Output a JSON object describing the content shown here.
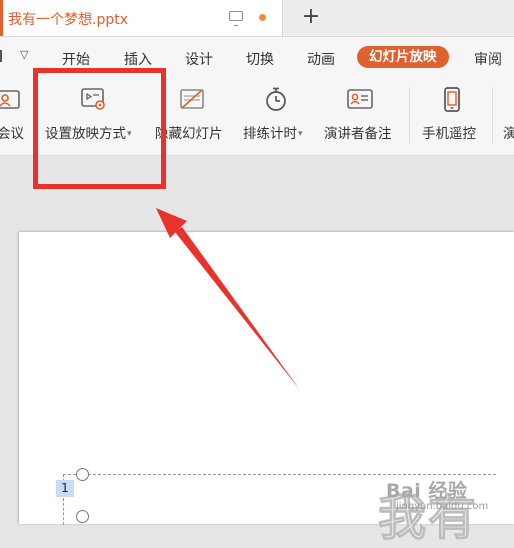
{
  "document": {
    "title": "我有一个梦想.pptx",
    "new_tab_symbol": "+",
    "accent_color": "#e0602e",
    "unsaved_dot_color": "#e8903b"
  },
  "menu": {
    "quick_access_dropdown": "▽",
    "items": [
      {
        "label": "开始"
      },
      {
        "label": "插入"
      },
      {
        "label": "设计"
      },
      {
        "label": "切换"
      },
      {
        "label": "动画"
      },
      {
        "label": "幻灯片放映",
        "active": true
      },
      {
        "label": "审阅"
      }
    ]
  },
  "toolbar": {
    "tools": [
      {
        "label": "会议",
        "icon": "meeting-icon"
      },
      {
        "label": "设置放映方式",
        "icon": "slideshow-settings-icon",
        "has_dropdown": true
      },
      {
        "label": "隐藏幻灯片",
        "icon": "hide-slide-icon"
      },
      {
        "label": "排练计时",
        "icon": "stopwatch-icon",
        "has_dropdown": true
      },
      {
        "label": "演讲者备注",
        "icon": "speaker-notes-icon"
      },
      {
        "label": "手机遥控",
        "icon": "phone-remote-icon"
      },
      {
        "label": "演",
        "icon": "presenter-icon"
      }
    ]
  },
  "slide": {
    "paragraph_number": "1",
    "title_text": "我有",
    "watermark_brand": "Bai 经验",
    "watermark_url": "jingyan.baidu.com"
  },
  "annotation": {
    "highlight_color": "#e8332c"
  }
}
